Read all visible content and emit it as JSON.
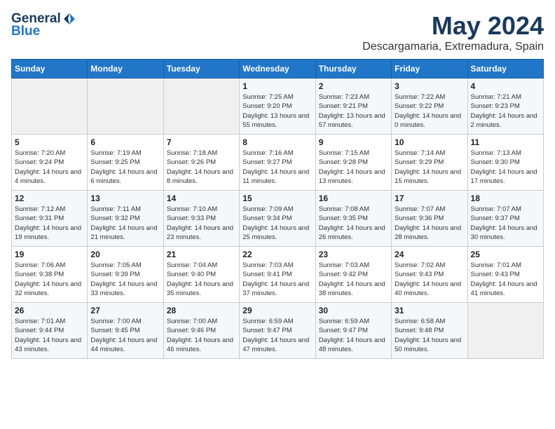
{
  "logo": {
    "general": "General",
    "blue": "Blue"
  },
  "title": "May 2024",
  "location": "Descargamaria, Extremadura, Spain",
  "weekdays": [
    "Sunday",
    "Monday",
    "Tuesday",
    "Wednesday",
    "Thursday",
    "Friday",
    "Saturday"
  ],
  "weeks": [
    [
      {
        "day": "",
        "sunrise": "",
        "sunset": "",
        "daylight": ""
      },
      {
        "day": "",
        "sunrise": "",
        "sunset": "",
        "daylight": ""
      },
      {
        "day": "",
        "sunrise": "",
        "sunset": "",
        "daylight": ""
      },
      {
        "day": "1",
        "sunrise": "Sunrise: 7:25 AM",
        "sunset": "Sunset: 9:20 PM",
        "daylight": "Daylight: 13 hours and 55 minutes."
      },
      {
        "day": "2",
        "sunrise": "Sunrise: 7:23 AM",
        "sunset": "Sunset: 9:21 PM",
        "daylight": "Daylight: 13 hours and 57 minutes."
      },
      {
        "day": "3",
        "sunrise": "Sunrise: 7:22 AM",
        "sunset": "Sunset: 9:22 PM",
        "daylight": "Daylight: 14 hours and 0 minutes."
      },
      {
        "day": "4",
        "sunrise": "Sunrise: 7:21 AM",
        "sunset": "Sunset: 9:23 PM",
        "daylight": "Daylight: 14 hours and 2 minutes."
      }
    ],
    [
      {
        "day": "5",
        "sunrise": "Sunrise: 7:20 AM",
        "sunset": "Sunset: 9:24 PM",
        "daylight": "Daylight: 14 hours and 4 minutes."
      },
      {
        "day": "6",
        "sunrise": "Sunrise: 7:19 AM",
        "sunset": "Sunset: 9:25 PM",
        "daylight": "Daylight: 14 hours and 6 minutes."
      },
      {
        "day": "7",
        "sunrise": "Sunrise: 7:18 AM",
        "sunset": "Sunset: 9:26 PM",
        "daylight": "Daylight: 14 hours and 8 minutes."
      },
      {
        "day": "8",
        "sunrise": "Sunrise: 7:16 AM",
        "sunset": "Sunset: 9:27 PM",
        "daylight": "Daylight: 14 hours and 11 minutes."
      },
      {
        "day": "9",
        "sunrise": "Sunrise: 7:15 AM",
        "sunset": "Sunset: 9:28 PM",
        "daylight": "Daylight: 14 hours and 13 minutes."
      },
      {
        "day": "10",
        "sunrise": "Sunrise: 7:14 AM",
        "sunset": "Sunset: 9:29 PM",
        "daylight": "Daylight: 14 hours and 15 minutes."
      },
      {
        "day": "11",
        "sunrise": "Sunrise: 7:13 AM",
        "sunset": "Sunset: 9:30 PM",
        "daylight": "Daylight: 14 hours and 17 minutes."
      }
    ],
    [
      {
        "day": "12",
        "sunrise": "Sunrise: 7:12 AM",
        "sunset": "Sunset: 9:31 PM",
        "daylight": "Daylight: 14 hours and 19 minutes."
      },
      {
        "day": "13",
        "sunrise": "Sunrise: 7:11 AM",
        "sunset": "Sunset: 9:32 PM",
        "daylight": "Daylight: 14 hours and 21 minutes."
      },
      {
        "day": "14",
        "sunrise": "Sunrise: 7:10 AM",
        "sunset": "Sunset: 9:33 PM",
        "daylight": "Daylight: 14 hours and 23 minutes."
      },
      {
        "day": "15",
        "sunrise": "Sunrise: 7:09 AM",
        "sunset": "Sunset: 9:34 PM",
        "daylight": "Daylight: 14 hours and 25 minutes."
      },
      {
        "day": "16",
        "sunrise": "Sunrise: 7:08 AM",
        "sunset": "Sunset: 9:35 PM",
        "daylight": "Daylight: 14 hours and 26 minutes."
      },
      {
        "day": "17",
        "sunrise": "Sunrise: 7:07 AM",
        "sunset": "Sunset: 9:36 PM",
        "daylight": "Daylight: 14 hours and 28 minutes."
      },
      {
        "day": "18",
        "sunrise": "Sunrise: 7:07 AM",
        "sunset": "Sunset: 9:37 PM",
        "daylight": "Daylight: 14 hours and 30 minutes."
      }
    ],
    [
      {
        "day": "19",
        "sunrise": "Sunrise: 7:06 AM",
        "sunset": "Sunset: 9:38 PM",
        "daylight": "Daylight: 14 hours and 32 minutes."
      },
      {
        "day": "20",
        "sunrise": "Sunrise: 7:05 AM",
        "sunset": "Sunset: 9:39 PM",
        "daylight": "Daylight: 14 hours and 33 minutes."
      },
      {
        "day": "21",
        "sunrise": "Sunrise: 7:04 AM",
        "sunset": "Sunset: 9:40 PM",
        "daylight": "Daylight: 14 hours and 35 minutes."
      },
      {
        "day": "22",
        "sunrise": "Sunrise: 7:03 AM",
        "sunset": "Sunset: 9:41 PM",
        "daylight": "Daylight: 14 hours and 37 minutes."
      },
      {
        "day": "23",
        "sunrise": "Sunrise: 7:03 AM",
        "sunset": "Sunset: 9:42 PM",
        "daylight": "Daylight: 14 hours and 38 minutes."
      },
      {
        "day": "24",
        "sunrise": "Sunrise: 7:02 AM",
        "sunset": "Sunset: 9:43 PM",
        "daylight": "Daylight: 14 hours and 40 minutes."
      },
      {
        "day": "25",
        "sunrise": "Sunrise: 7:01 AM",
        "sunset": "Sunset: 9:43 PM",
        "daylight": "Daylight: 14 hours and 41 minutes."
      }
    ],
    [
      {
        "day": "26",
        "sunrise": "Sunrise: 7:01 AM",
        "sunset": "Sunset: 9:44 PM",
        "daylight": "Daylight: 14 hours and 43 minutes."
      },
      {
        "day": "27",
        "sunrise": "Sunrise: 7:00 AM",
        "sunset": "Sunset: 9:45 PM",
        "daylight": "Daylight: 14 hours and 44 minutes."
      },
      {
        "day": "28",
        "sunrise": "Sunrise: 7:00 AM",
        "sunset": "Sunset: 9:46 PM",
        "daylight": "Daylight: 14 hours and 46 minutes."
      },
      {
        "day": "29",
        "sunrise": "Sunrise: 6:59 AM",
        "sunset": "Sunset: 9:47 PM",
        "daylight": "Daylight: 14 hours and 47 minutes."
      },
      {
        "day": "30",
        "sunrise": "Sunrise: 6:59 AM",
        "sunset": "Sunset: 9:47 PM",
        "daylight": "Daylight: 14 hours and 48 minutes."
      },
      {
        "day": "31",
        "sunrise": "Sunrise: 6:58 AM",
        "sunset": "Sunset: 9:48 PM",
        "daylight": "Daylight: 14 hours and 50 minutes."
      },
      {
        "day": "",
        "sunrise": "",
        "sunset": "",
        "daylight": ""
      }
    ]
  ]
}
